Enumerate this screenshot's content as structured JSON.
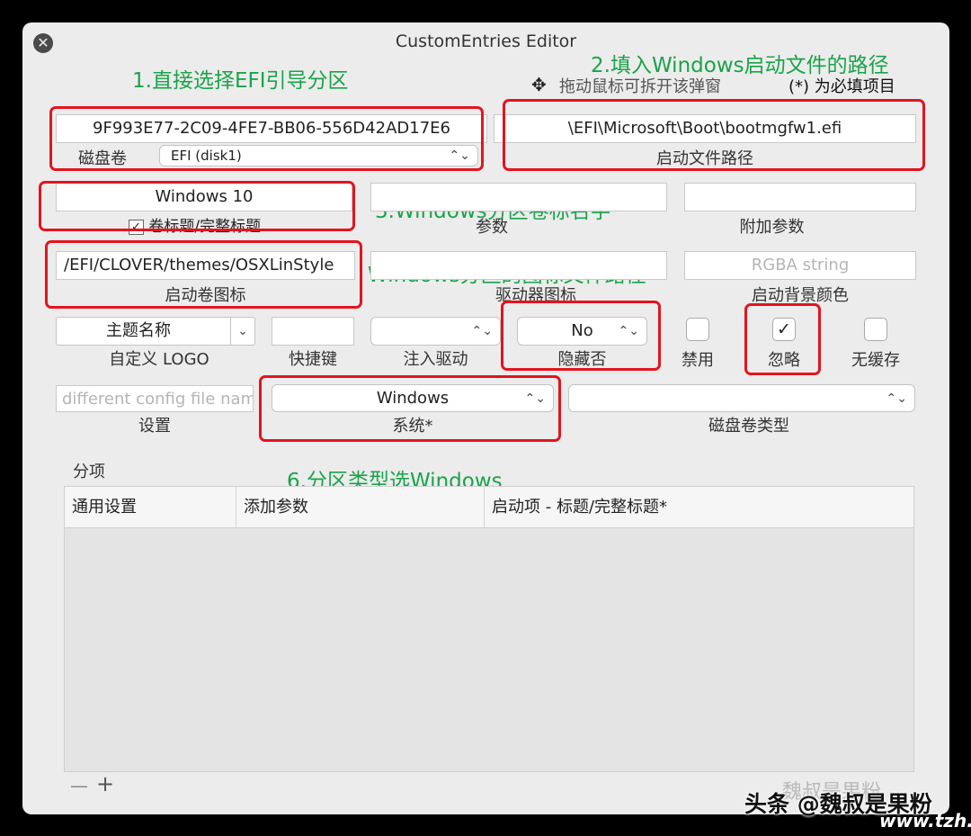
{
  "window": {
    "title": "CustomEntries Editor"
  },
  "annotations": {
    "step1": "1.直接选择EFI引导分区",
    "step2": "2.填入Windows启动文件的路径",
    "step3": "3.Windows分区卷标名字",
    "step4": "Windows分区的图标文件路径",
    "step6": "6.分区类型选Windows"
  },
  "header": {
    "drag_hint": "拖动鼠标可拆开该弹窗",
    "required_note": "(*) 为必填项目"
  },
  "volume": {
    "uuid": "9F993E77-2C09-4FE7-BB06-556D42AD17E6",
    "label": "磁盘卷",
    "selected": "EFI (disk1)"
  },
  "path": {
    "value": "\\EFI\\Microsoft\\Boot\\bootmgfw1.efi",
    "label": "启动文件路径"
  },
  "title_field": {
    "value": "Windows 10",
    "checkbox_label": "卷标题/完整标题"
  },
  "args": {
    "label": "参数"
  },
  "add_args": {
    "label": "附加参数"
  },
  "icon": {
    "value": "/EFI/CLOVER/themes/OSXLinStyle",
    "label": "启动卷图标"
  },
  "driver_icon": {
    "label": "驱动器图标"
  },
  "bg_color": {
    "placeholder": "RGBA string",
    "label": "启动背景颜色"
  },
  "theme": {
    "value": "主题名称",
    "label": "自定义 LOGO"
  },
  "hotkey": {
    "label": "快捷键"
  },
  "inject": {
    "label": "注入驱动"
  },
  "hidden": {
    "value": "No",
    "label": "隐藏否"
  },
  "disabled": {
    "label": "禁用"
  },
  "ignore": {
    "label": "忽略",
    "checked": true
  },
  "nocache": {
    "label": "无缓存"
  },
  "settings": {
    "placeholder": "different config file name",
    "label": "设置"
  },
  "os": {
    "value": "Windows",
    "label": "系统*"
  },
  "vol_type": {
    "label": "磁盘卷类型"
  },
  "subentries": {
    "label": "分项",
    "columns": [
      "通用设置",
      "添加参数",
      "启动项 - 标题/完整标题*"
    ],
    "add": "+",
    "remove": "—"
  },
  "watermark": {
    "line1": "魏叔是果粉",
    "line2": "头条 @魏叔是果粉",
    "site": "www.tzh.net"
  }
}
